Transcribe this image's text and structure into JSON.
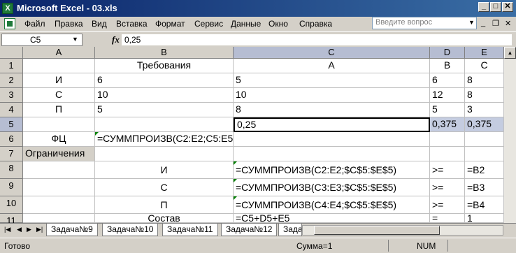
{
  "window": {
    "title": "Microsoft Excel - 03.xls",
    "app_icon_letter": "X",
    "buttons": {
      "minimize": "_",
      "maximize": "□",
      "close": "✕"
    }
  },
  "menu": {
    "items": [
      "Файл",
      "Правка",
      "Вид",
      "Вставка",
      "Формат",
      "Сервис",
      "Данные",
      "Окно",
      "Справка"
    ],
    "help_placeholder": "Введите вопрос",
    "mdi": {
      "minimize": "_",
      "restore": "❐",
      "close": "✕"
    }
  },
  "formula_bar": {
    "name_box": "C5",
    "fx_label": "fx",
    "formula": "0,25"
  },
  "grid": {
    "columns": [
      "A",
      "B",
      "C",
      "D",
      "E"
    ],
    "selected_column": "C",
    "selected_row": "5",
    "rows": [
      {
        "num": "1",
        "cells": [
          "",
          "Требования",
          "A",
          "B",
          "C"
        ]
      },
      {
        "num": "2",
        "cells": [
          "И",
          "6",
          "5",
          "6",
          "8"
        ]
      },
      {
        "num": "3",
        "cells": [
          "С",
          "10",
          "10",
          "12",
          "8"
        ]
      },
      {
        "num": "4",
        "cells": [
          "П",
          "5",
          "8",
          "5",
          "3"
        ]
      },
      {
        "num": "5",
        "cells": [
          "",
          "",
          "0,25",
          "0,375",
          "0,375"
        ]
      },
      {
        "num": "6",
        "cells": [
          "ФЦ",
          "=СУММПРОИЗВ(C2:E2;C5:E5)",
          "",
          "",
          ""
        ]
      },
      {
        "num": "7",
        "cells": [
          "Ограничения",
          "",
          "",
          "",
          ""
        ]
      },
      {
        "num": "8",
        "cells": [
          "",
          "И",
          "=СУММПРОИЗВ(C2:E2;$C$5:$E$5)",
          ">=",
          "=B2"
        ]
      },
      {
        "num": "9",
        "cells": [
          "",
          "С",
          "=СУММПРОИЗВ(C3:E3;$C$5:$E$5)",
          ">=",
          "=B3"
        ]
      },
      {
        "num": "10",
        "cells": [
          "",
          "П",
          "=СУММПРОИЗВ(C4:E4;$C$5:$E$5)",
          ">=",
          "=B4"
        ]
      },
      {
        "num": "11",
        "cells": [
          "",
          "Состав",
          "=C5+D5+E5",
          "=",
          "1"
        ]
      }
    ]
  },
  "sheet_tabs": [
    "Задача№9",
    "Задача№10",
    "Задача№11",
    "Задача№12",
    "Задач"
  ],
  "status": {
    "ready": "Готово",
    "sum": "Сумма=1",
    "num": "NUM"
  }
}
